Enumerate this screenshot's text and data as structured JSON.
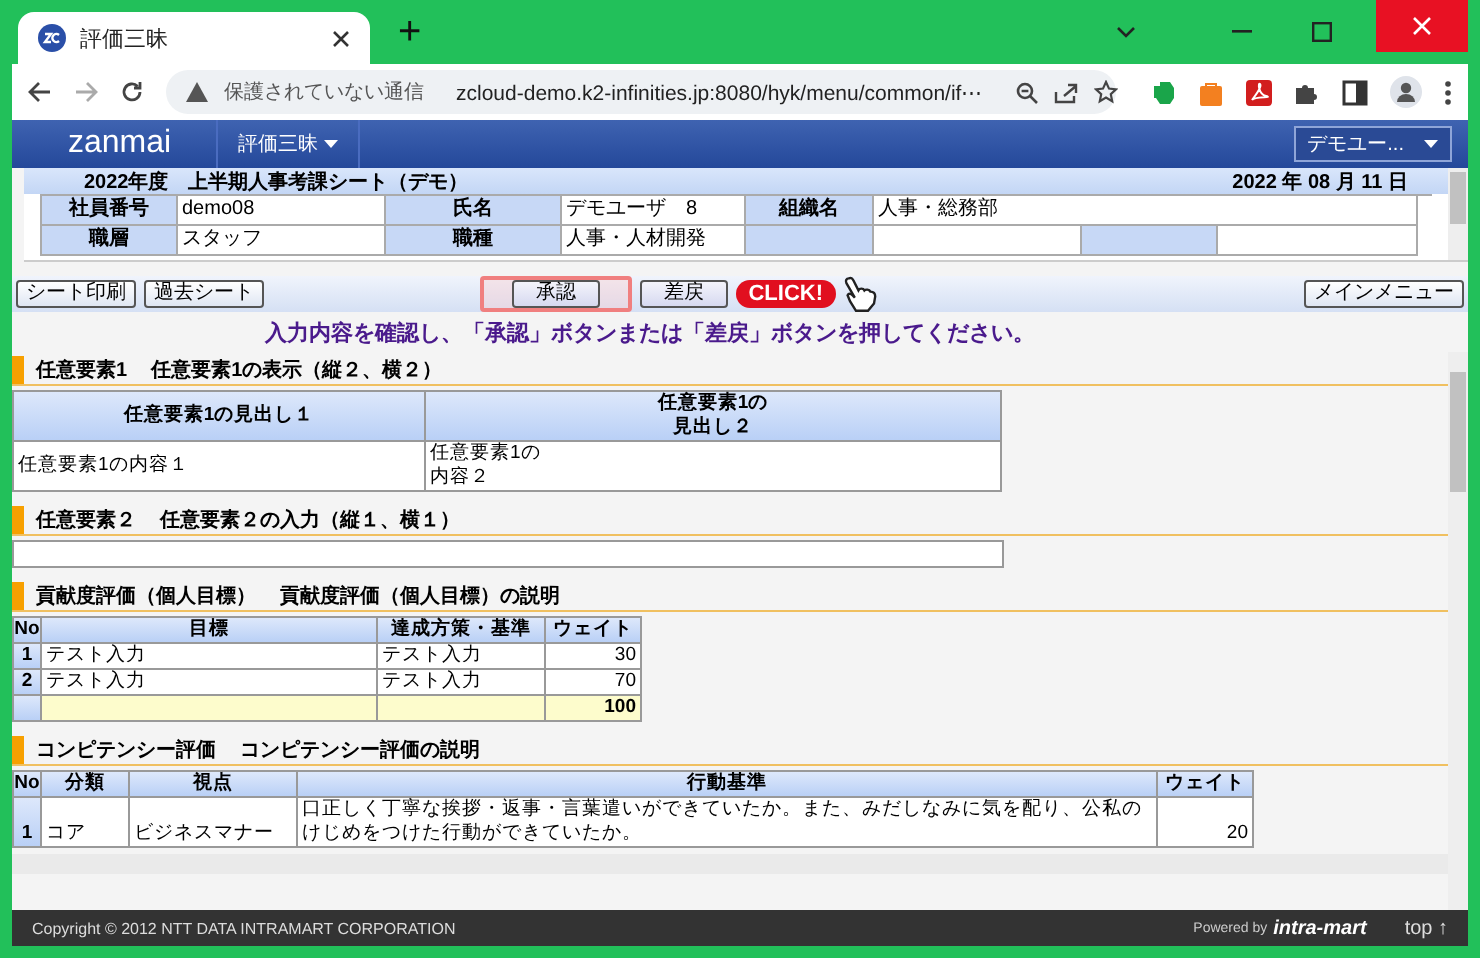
{
  "browser": {
    "tab_title": "評価三昧",
    "new_tab": "+",
    "security": "保護されていない通信",
    "url": "zcloud-demo.k2-infinities.jp:8080/hyk/menu/common/if⋯"
  },
  "app": {
    "logo": "zanmai",
    "menu": "評価三昧",
    "user_menu": "デモユー..."
  },
  "sheet": {
    "title": "2022年度　上半期人事考課シート（デモ）",
    "date": "2022 年 08 月 11 日",
    "fields": [
      {
        "label": "社員番号",
        "value": "demo08"
      },
      {
        "label": "氏名",
        "value": "デモユーザ　8"
      },
      {
        "label": "組織名",
        "value": "人事・総務部"
      },
      {
        "label": "職層",
        "value": "スタッフ"
      },
      {
        "label": "職種",
        "value": "人事・人材開発"
      }
    ]
  },
  "toolbar": {
    "left_buttons": [
      "シート印刷",
      "過去シート"
    ],
    "actions": [
      {
        "label": "承認",
        "highlighted": true
      },
      {
        "label": "差戻",
        "highlighted": false
      }
    ],
    "main_menu": "メインメニュー"
  },
  "callout": "CLICK!",
  "message": "入力内容を確認し、「承認」ボタンまたは「差戻」ボタンを押してください。",
  "sections": [
    {
      "kind": "matrix",
      "title": "任意要素1",
      "description": "任意要素1の表示（縦２、横２）",
      "headers": [
        "任意要素1の見出し１",
        "任意要素1の見出し２"
      ],
      "cells": [
        "任意要素1の内容１",
        "任意要素1の内容２"
      ]
    },
    {
      "kind": "input",
      "title": "任意要素２",
      "description": "任意要素２の入力（縦１、横１）"
    },
    {
      "kind": "goals",
      "title": "貢献度評価（個人目標）",
      "description": "貢献度評価（個人目標）の説明",
      "columns": [
        "No",
        "目標",
        "達成方策・基準",
        "ウェイト"
      ],
      "rows": [
        {
          "cells": [
            "1",
            "テスト入力",
            "テスト入力",
            "30"
          ]
        },
        {
          "cells": [
            "2",
            "テスト入力",
            "テスト入力",
            "70"
          ]
        }
      ],
      "total": "100"
    },
    {
      "kind": "competency",
      "title": "コンピテンシー評価",
      "description": "コンピテンシー評価の説明",
      "columns": [
        "No",
        "分類",
        "視点",
        "行動基準",
        "ウェイト"
      ],
      "rows": [
        {
          "cells": [
            "1",
            "コア",
            "ビジネスマナー",
            "口正しく丁寧な挨拶・返事・言葉遣いができていたか。また、みだしなみに気を配り、公私のけじめをつけた行動ができていたか。",
            "20"
          ]
        }
      ]
    }
  ],
  "footer": {
    "copyright": "Copyright © 2012 NTT DATA INTRAMART CORPORATION",
    "powered": "Powered by",
    "brand": "intra-mart",
    "top": "top ↑"
  }
}
